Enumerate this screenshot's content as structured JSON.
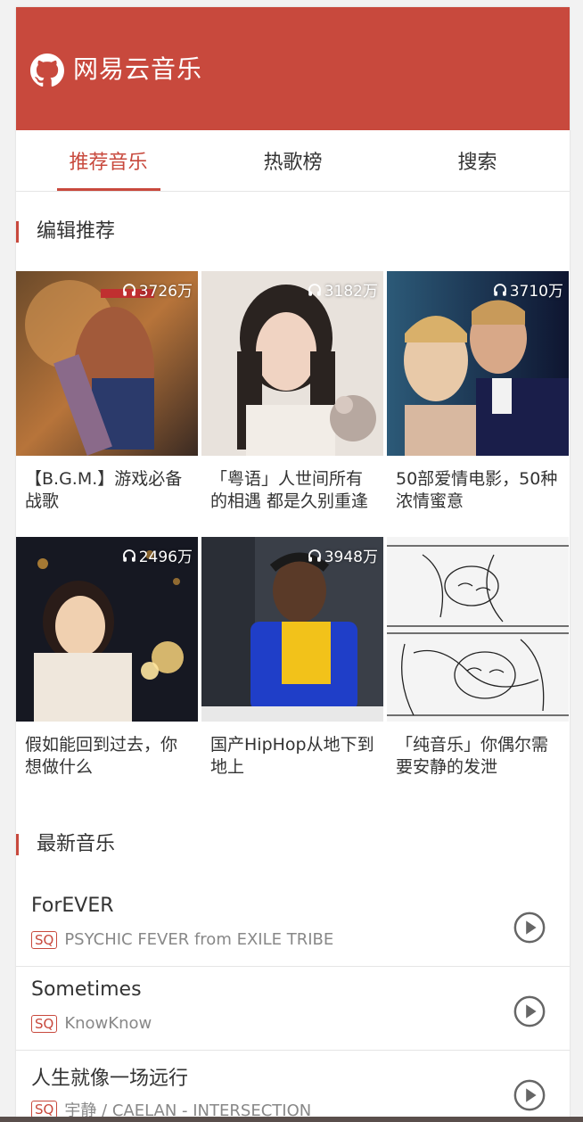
{
  "app": {
    "title": "网易云音乐",
    "logo_icon": "github-icon"
  },
  "tabs": [
    {
      "label": "推荐音乐",
      "active": true
    },
    {
      "label": "热歌榜",
      "active": false
    },
    {
      "label": "搜索",
      "active": false
    }
  ],
  "recommend": {
    "title": "编辑推荐",
    "playlists": [
      {
        "count": "3726万",
        "title": "【B.G.M.】游戏必备战歌"
      },
      {
        "count": "3182万",
        "title": "「粤语」人世间所有的相遇 都是久别重逢"
      },
      {
        "count": "3710万",
        "title": "50部爱情电影，50种浓情蜜意"
      },
      {
        "count": "2496万",
        "title": "假如能回到过去，你想做什么"
      },
      {
        "count": "3948万",
        "title": "国产HipHop从地下到地上"
      },
      {
        "count": "",
        "title": "「纯音乐」你偶尔需要安静的发泄"
      }
    ]
  },
  "latest": {
    "title": "最新音乐",
    "songs": [
      {
        "name": "ForEVER",
        "badge": "SQ",
        "artist": "PSYCHIC FEVER from EXILE TRIBE"
      },
      {
        "name": "Sometimes",
        "badge": "SQ",
        "artist": "KnowKnow"
      },
      {
        "name": "人生就像一场远行",
        "badge": "SQ",
        "artist": "宇静 / CAELAN - INTERSECTION"
      }
    ]
  },
  "colors": {
    "brand": "#c8493d",
    "text": "#333333",
    "muted": "#888888"
  }
}
